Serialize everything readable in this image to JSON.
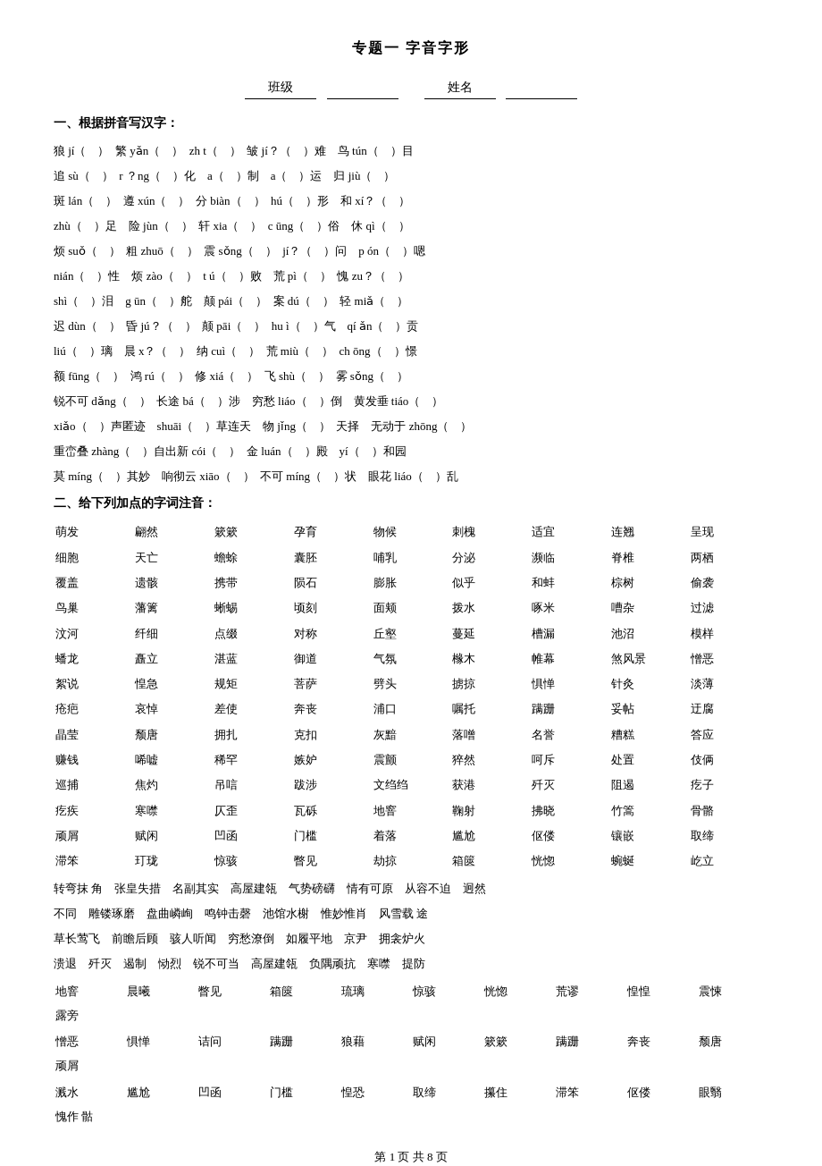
{
  "title": "专题一  字音字形",
  "class_label": "班级",
  "name_label": "姓名",
  "section1_title": "一、根据拼音写汉字：",
  "section2_title": "二、给下列加点的字词注音：",
  "footer": "第  1  页    共  8  页",
  "pinyin_lines": [
    "狼 jí（    ）  繁 yǎn（    ）zh t（    ）  皱 jí？（    ）难    鸟 tún（    ）目",
    "追 sù（    ）  r  ？ng（    ）化    a（    ）制    a（    ）运    归 jiù（    ）",
    "斑 lán（    ）  遵 xún（    ）  分 biàn（    ）  hú（    ）形    和 xí？（    ）",
    "zhù（    ）足    险 jùn（    ）  轩 xia（    ）  c  ūng（    ）俗    休 qì（    ）",
    "烦 suǒ（    ）  粗 zhuō（    ）  震 sǒng（    ）  jí？（    ）问    p  ón（    ）嗯",
    "nián（    ）性    烦 zào（    ）  t ú（    ）败    荒 pì（    ）  愧 zu？（    ）",
    "shì（    ）泪    g ūn（    ）舵    颠 pái（    ）  案 dú（    ）  轻 miǎ（    ）",
    "迟 dùn（    ）  昏 jú？（    ）  颠 pāi（    ）  hu ì（    ）气    qí  ǎn（    ）贡",
    "liú（    ）璃    晨 x？（    ）  纳 cuì（    ）  荒 miù（    ）  ch ōng（    ）憬",
    "额 fūng（    ）  鸿 rú（    ）  修 xiá（    ）  飞 shù（    ）  雾 sǒng（    ）",
    "锐不可 dǎng（    ）长途 bá（    ）涉    穷愁 liáo（    ）倒    黄发垂 tiáo（    ）",
    "xiǎo（    ）声匿迹    shuāi（    ）草连天    物 jǐng（    ）  天择    无动于 zhōng（    ）",
    "重峦叠 zhàng（    ）自出新 cói（    ）  金 luán（    ）殿    yí（    ）和园",
    "莫 míng（    ）其妙    响彻云 xiāo（    ）  不可 míng（    ）状    眼花 liáo（    ）乱"
  ],
  "section2_words_rows": [
    [
      "萌发",
      "翩然",
      "簌簌",
      "孕育",
      "物候",
      "刺槐",
      "适宜",
      "连翘",
      "呈现"
    ],
    [
      "细胞",
      "天亡",
      "蟾蜍",
      "囊胚",
      "哺乳",
      "分泌",
      "濒临",
      "脊椎",
      "两栖"
    ],
    [
      "覆盖",
      "遗骸",
      "携带",
      "陨石",
      "膨胀",
      "似乎",
      "和蚌",
      "棕树",
      "偷袭"
    ],
    [
      "鸟巢",
      "藩篱",
      "蜥蜴",
      "顷刻",
      "面颊",
      "拨水",
      "啄米",
      "嘈杂",
      "过滤"
    ],
    [
      "汶河",
      "纤细",
      "点缀",
      "对称",
      "丘壑",
      "蔓延",
      "槽漏",
      "池沼",
      "模样"
    ],
    [
      "蟠龙",
      "矗立",
      "湛蓝",
      "御道",
      "气氛",
      "橼木",
      "帷幕",
      "煞风景",
      "憎恶"
    ],
    [
      "絮说",
      "惶急",
      "规矩",
      "菩萨",
      "劈头",
      "掳掠",
      "惧惮",
      "针灸",
      "淡薄"
    ],
    [
      "疮疤",
      "哀悼",
      "差使",
      "奔丧",
      "浦口",
      "嘱托",
      "蹒跚",
      "妥帖",
      "迂腐"
    ],
    [
      "晶莹",
      "颓唐",
      "拥扎",
      "克扣",
      "灰黯",
      "落噌",
      "名誉",
      "糟糕",
      "答应"
    ],
    [
      "赚钱",
      "唏嘘",
      "稀罕",
      "嫉妒",
      "震颤",
      "猝然",
      "呵斥",
      "处置",
      "伎俩"
    ],
    [
      "巡捕",
      "焦灼",
      "吊唁",
      "跋涉",
      "文绉绉",
      "获港",
      "歼灭",
      "阻遏",
      "疙子"
    ],
    [
      "疙疾",
      "寒噤",
      "仄歪",
      "瓦砾",
      "地窨",
      "鞠射",
      "拂晓",
      "竹篙",
      "骨骼"
    ],
    [
      "顽屑",
      "赋闲",
      "凹函",
      "门槛",
      "着落",
      "尴尬",
      "伛偻",
      "镶嵌",
      "取缔"
    ],
    [
      "滞笨",
      "玎珑",
      "惊骇",
      "瞥见",
      "劫掠",
      "箱篋",
      "恍惚",
      "蜿蜒",
      "屹立"
    ]
  ],
  "idiom_lines": [
    "转弯抹 角    张皇失措    名副其实    高屋建瓴    气势磅礴    情有可原    从容不迫    迥然",
    "不同    雕镂琢磨    盘曲嶙峋    鸣钟击磬    池馆水榭    惟妙惟肖    风雪载 途",
    "草长莺飞    前瞻后顾    骇人听闻    穷愁潦倒    如履平地    京尹    拥衾炉火",
    "溃退    歼灭    遏制    恸烈    锐不可当    高屋建瓴    负隅顽抗    寒噤    提防"
  ],
  "final_words_rows": [
    [
      "地窨",
      "晨曦",
      "瞥见",
      "箱篋",
      "琉璃",
      "惊骇",
      "恍惚",
      "荒谬",
      "惶惶",
      "震悚",
      "露旁"
    ],
    [
      "憎恶",
      "惧惮",
      "诘问",
      "蹒跚",
      "狼藉",
      "赋闲",
      "簌簌",
      "蹒跚",
      "奔丧",
      "颓唐",
      "顽屑"
    ],
    [
      "溅水",
      "尴尬",
      "凹函",
      "门槛",
      "惶恐",
      "取缔",
      "攥住",
      "滞笨",
      "伛偻",
      "眼翳",
      "愧作",
      "骷"
    ]
  ]
}
